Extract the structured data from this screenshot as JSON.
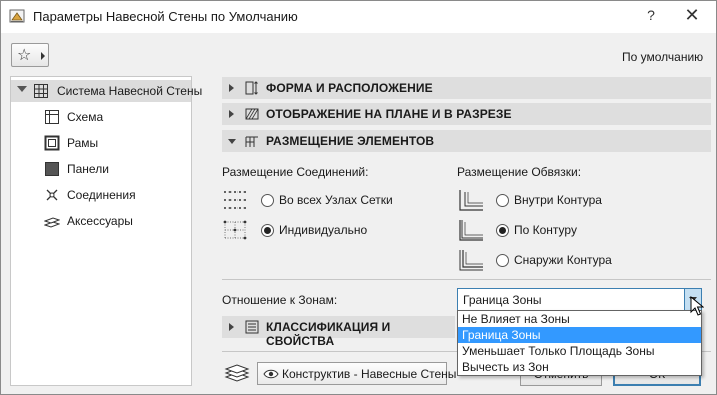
{
  "window": {
    "title": "Параметры Навесной Стены по Умолчанию",
    "help_label": "?",
    "close_label": "✕"
  },
  "toolbar": {
    "default_label": "По умолчанию"
  },
  "sidebar": {
    "items": [
      {
        "label": "Система Навесной Стены",
        "icon": "curtain-wall-system-icon"
      },
      {
        "label": "Схема",
        "icon": "scheme-icon"
      },
      {
        "label": "Рамы",
        "icon": "frames-icon"
      },
      {
        "label": "Панели",
        "icon": "panels-icon"
      },
      {
        "label": "Соединения",
        "icon": "junctions-icon"
      },
      {
        "label": "Аксессуары",
        "icon": "accessories-icon"
      }
    ]
  },
  "sections": {
    "shape": "ФОРМА И РАСПОЛОЖЕНИЕ",
    "plan": "ОТОБРАЖЕНИЕ НА ПЛАНЕ И В РАЗРЕЗЕ",
    "placement": "РАЗМЕЩЕНИЕ ЭЛЕМЕНТОВ",
    "classification": "КЛАССИФИКАЦИЯ И СВОЙСТВА"
  },
  "junctions": {
    "label": "Размещение Соединений:",
    "options": [
      "Во всех Узлах Сетки",
      "Индивидуально"
    ],
    "selected": 1
  },
  "boundary": {
    "label": "Размещение Обвязки:",
    "options": [
      "Внутри Контура",
      "По Контуру",
      "Снаружи Контура"
    ],
    "selected": 1
  },
  "zones": {
    "label": "Отношение к Зонам:",
    "value": "Граница Зоны",
    "options": [
      "Не Влияет на Зоны",
      "Граница Зоны",
      "Уменьшает Только Площадь Зоны",
      "Вычесть из Зон"
    ],
    "highlighted": 1
  },
  "footer": {
    "layer_value": "Конструктив - Навесные Стены",
    "cancel_label": "Отменить",
    "ok_label": "ОК"
  }
}
